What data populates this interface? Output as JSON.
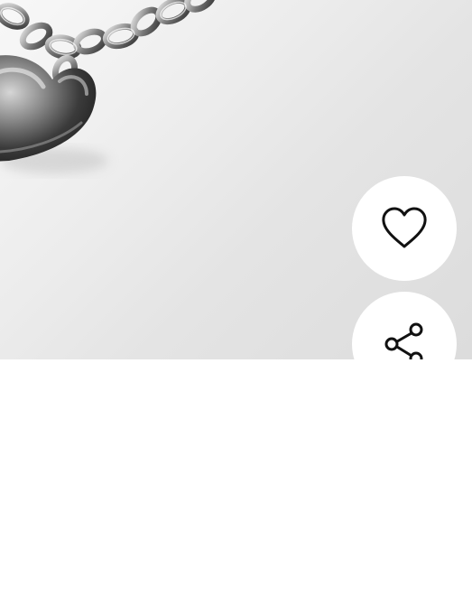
{
  "product": {
    "image_icon": "heart-pendant-chain-photo",
    "background_color": "#e8e8e8"
  },
  "actions": {
    "like_icon": "heart-outline-icon",
    "share_icon": "share-icon",
    "button_color": "#ffffff",
    "icon_color": "#111111"
  }
}
